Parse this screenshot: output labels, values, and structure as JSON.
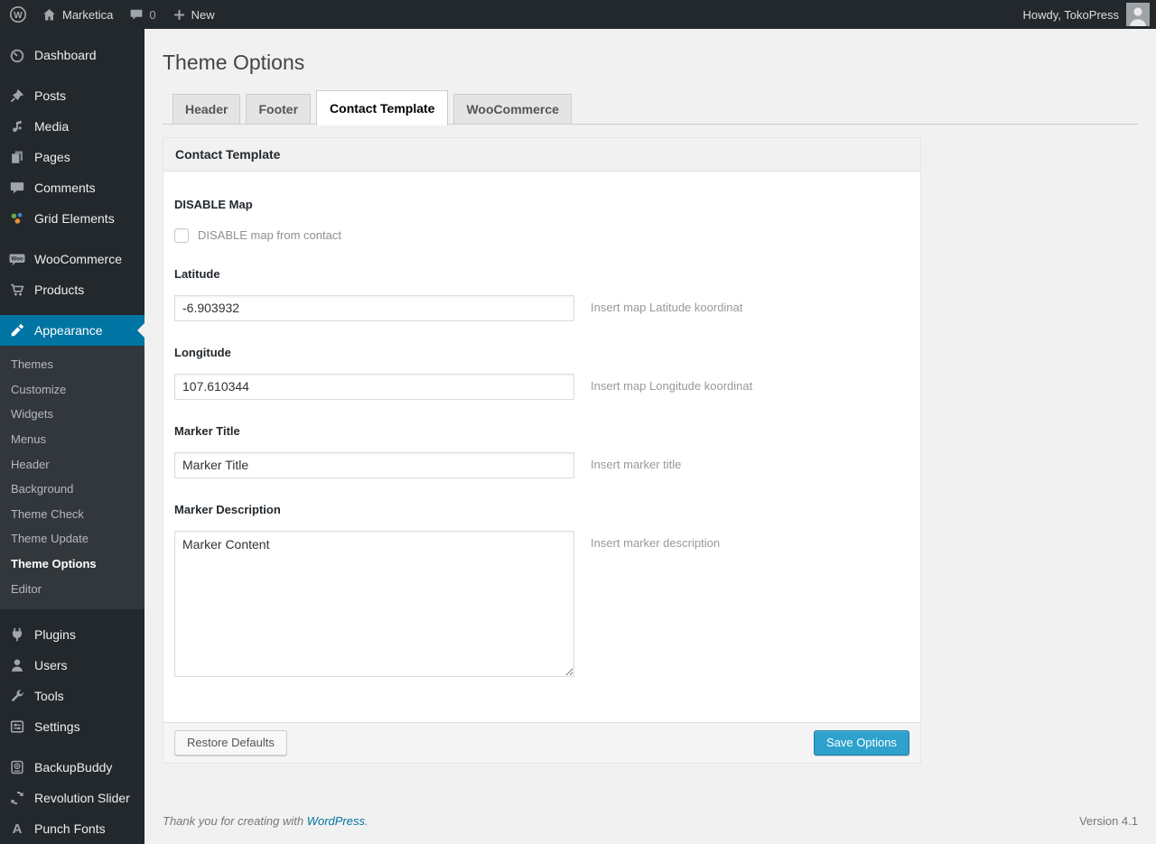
{
  "admin_bar": {
    "site_name": "Marketica",
    "comments_count": "0",
    "new_label": "New",
    "howdy": "Howdy, TokoPress"
  },
  "sidebar": {
    "items": [
      {
        "label": "Dashboard",
        "icon": "dashboard-icon"
      },
      {
        "label": "Posts",
        "icon": "pushpin-icon"
      },
      {
        "label": "Media",
        "icon": "media-icon"
      },
      {
        "label": "Pages",
        "icon": "pages-icon"
      },
      {
        "label": "Comments",
        "icon": "comments-icon"
      },
      {
        "label": "Grid Elements",
        "icon": "grid-elements-icon"
      },
      {
        "label": "WooCommerce",
        "icon": "woocommerce-icon"
      },
      {
        "label": "Products",
        "icon": "cart-icon"
      },
      {
        "label": "Appearance",
        "icon": "paintbrush-icon",
        "current": true
      },
      {
        "label": "Plugins",
        "icon": "plugin-icon"
      },
      {
        "label": "Users",
        "icon": "users-icon"
      },
      {
        "label": "Tools",
        "icon": "wrench-icon"
      },
      {
        "label": "Settings",
        "icon": "settings-icon"
      },
      {
        "label": "BackupBuddy",
        "icon": "backup-icon"
      },
      {
        "label": "Revolution Slider",
        "icon": "revolution-slider-icon"
      },
      {
        "label": "Punch Fonts",
        "icon": "font-a-icon"
      }
    ],
    "appearance_submenu": {
      "items": [
        "Themes",
        "Customize",
        "Widgets",
        "Menus",
        "Header",
        "Background",
        "Theme Check",
        "Theme Update",
        "Theme Options",
        "Editor"
      ],
      "current": "Theme Options"
    }
  },
  "main": {
    "title": "Theme Options",
    "tabs": [
      {
        "label": "Header",
        "active": false
      },
      {
        "label": "Footer",
        "active": false
      },
      {
        "label": "Contact Template",
        "active": true
      },
      {
        "label": "WooCommerce",
        "active": false
      }
    ],
    "panel": {
      "header_title": "Contact Template",
      "sections": [
        {
          "label": "DISABLE Map",
          "type": "checkbox",
          "checkbox_label": "DISABLE map from contact",
          "checked": false
        },
        {
          "label": "Latitude",
          "type": "text",
          "value": "-6.903932",
          "help": "Insert map Latitude koordinat"
        },
        {
          "label": "Longitude",
          "type": "text",
          "value": "107.610344",
          "help": "Insert map Longitude koordinat"
        },
        {
          "label": "Marker Title",
          "type": "text",
          "value": "Marker Title",
          "help": "Insert marker title"
        },
        {
          "label": "Marker Description",
          "type": "textarea",
          "value": "Marker Content",
          "help": "Insert marker description"
        }
      ],
      "actions": {
        "restore": "Restore Defaults",
        "save": "Save Options"
      }
    }
  },
  "footer": {
    "thanks_prefix": "Thank you for creating with",
    "link_label": "WordPress",
    "suffix": ".",
    "version": "Version 4.1"
  },
  "colors": {
    "admin_bar_bg": "#23282d",
    "menu_highlight": "#0074a2",
    "primary_button": "#2ea2cc",
    "link": "#0074a2"
  }
}
